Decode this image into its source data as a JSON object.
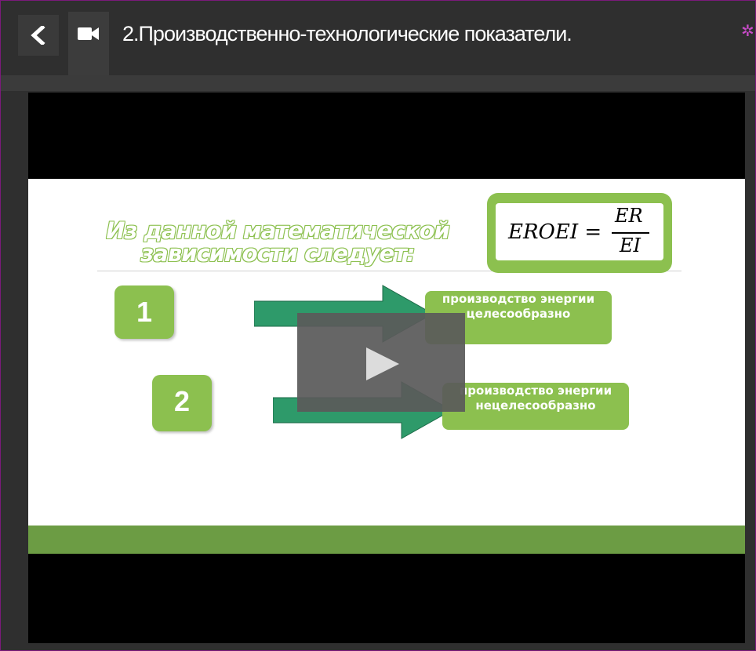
{
  "header": {
    "back_label": "‹",
    "title": "2.Производственно-технологические показатели."
  },
  "icons": {
    "back": "chevron-left-icon",
    "video": "video-camera-icon",
    "settings": "gear-icon",
    "play": "play-icon"
  },
  "colors": {
    "accent_green": "#8cc04f",
    "dark_green": "#6c9c44",
    "frame_border": "#7b1a7b",
    "header_bg": "#2f2f2f"
  },
  "slide": {
    "heading_line1": "Из данной математической",
    "heading_line2": "зависимости следует:",
    "formula": {
      "lhs": "EROEI =",
      "numerator": "ER",
      "denominator": "EI"
    },
    "items": [
      {
        "number": "1",
        "result": "производство энергии целесообразно"
      },
      {
        "number": "2",
        "result": "производство энергии нецелесообразно"
      }
    ]
  }
}
